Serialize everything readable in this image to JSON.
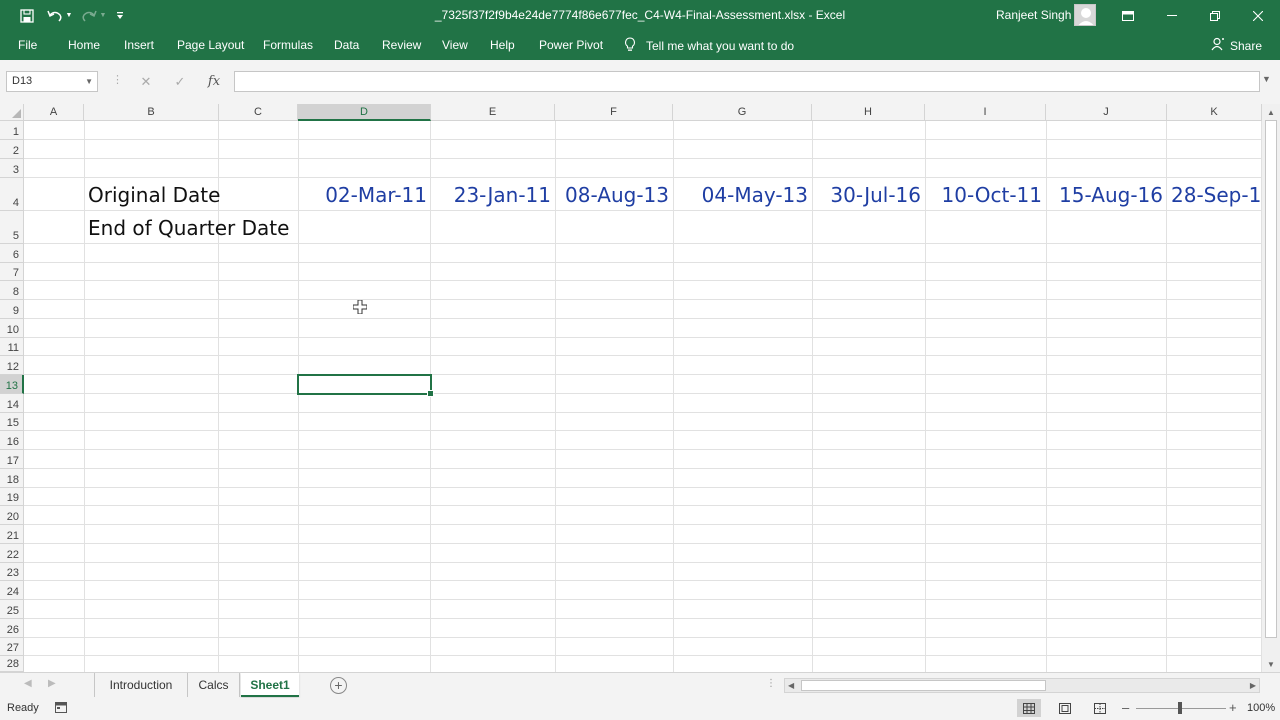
{
  "window": {
    "title": "_7325f37f2f9b4e24de7774f86e677fec_C4-W4-Final-Assessment.xlsx  -  Excel",
    "user": "Ranjeet Singh"
  },
  "ribbon": {
    "tabs": [
      "File",
      "Home",
      "Insert",
      "Page Layout",
      "Formulas",
      "Data",
      "Review",
      "View",
      "Help",
      "Power Pivot"
    ],
    "tell_me": "Tell me what you want to do",
    "share": "Share"
  },
  "formula_bar": {
    "name_box": "D13",
    "formula": ""
  },
  "grid": {
    "columns": [
      "A",
      "B",
      "C",
      "D",
      "E",
      "F",
      "G",
      "H",
      "I",
      "J",
      "K"
    ],
    "rows": [
      "1",
      "2",
      "3",
      "4",
      "5",
      "6",
      "7",
      "8",
      "9",
      "10",
      "11",
      "12",
      "13",
      "14",
      "15",
      "16",
      "17",
      "18",
      "19",
      "20",
      "21",
      "22",
      "23",
      "24",
      "25",
      "26",
      "27",
      "28"
    ],
    "selected_column": "D",
    "selected_row": "13",
    "labels": {
      "original_date": "Original Date",
      "end_of_quarter": "End of Quarter Date"
    },
    "dates": [
      "02-Mar-11",
      "23-Jan-11",
      "08-Aug-13",
      "04-May-13",
      "30-Jul-16",
      "10-Oct-11",
      "15-Aug-16",
      "28-Sep-1"
    ],
    "colors": {
      "date_text": "#1f3ea3",
      "accent": "#217346"
    }
  },
  "sheets": {
    "tabs": [
      "Introduction",
      "Calcs",
      "Sheet1"
    ],
    "active": "Sheet1"
  },
  "status": {
    "ready": "Ready",
    "zoom": "100%"
  }
}
